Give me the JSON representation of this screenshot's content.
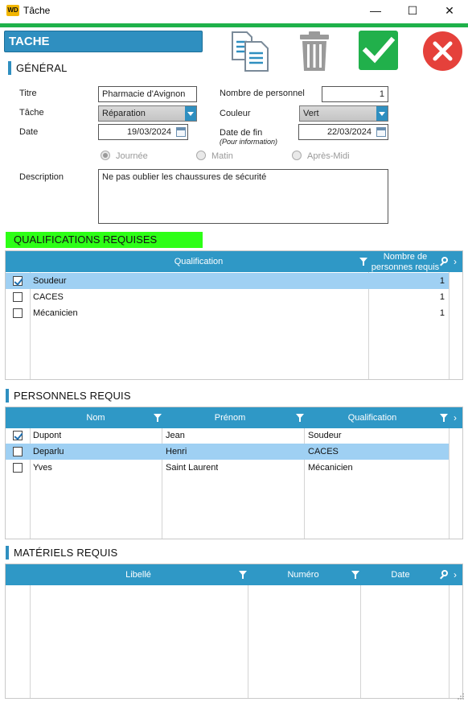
{
  "window": {
    "app_icon": "WD",
    "title": "Tâche",
    "min": "—",
    "max": "☐",
    "close": "✕"
  },
  "header": {
    "banner": "TACHE",
    "section_general": "GÉNÉRAL",
    "tools": [
      "copy-document-icon",
      "trash-icon",
      "validate-check-icon",
      "cancel-x-icon"
    ],
    "colors": {
      "accent": "#2f8fc0",
      "validate": "#21b04b",
      "cancel": "#e5413b",
      "green_line": "#1fb14a"
    }
  },
  "form": {
    "titre_label": "Titre",
    "titre_value": "Pharmacie d'Avignon",
    "tache_label": "Tâche",
    "tache_value": "Réparation",
    "date_label": "Date",
    "date_value": "19/03/2024",
    "nb_personnel_label": "Nombre de personnel",
    "nb_personnel_value": "1",
    "couleur_label": "Couleur",
    "couleur_value": "Vert",
    "date_fin_label": "Date de fin",
    "date_fin_sub": "(Pour information)",
    "date_fin_value": "22/03/2024",
    "radio_journee": "Journée",
    "radio_matin": "Matin",
    "radio_apres_midi": "Après-Midi",
    "description_label": "Description",
    "description_value": "Ne pas oublier les chaussures de sécurité"
  },
  "qualifications": {
    "title": "QUALIFICATIONS REQUISES",
    "col_qualification": "Qualification",
    "col_nombre_1": "Nombre de",
    "col_nombre_2": "personnes requis",
    "rows": [
      {
        "checked": true,
        "name": "Soudeur",
        "count": "1"
      },
      {
        "checked": false,
        "name": "CACES",
        "count": "1"
      },
      {
        "checked": false,
        "name": "Mécanicien",
        "count": "1"
      }
    ]
  },
  "personnels": {
    "title": "PERSONNELS REQUIS",
    "col_nom": "Nom",
    "col_prenom": "Prénom",
    "col_qualification": "Qualification",
    "rows": [
      {
        "checked": true,
        "nom": "Dupont",
        "prenom": "Jean",
        "qualification": "Soudeur"
      },
      {
        "checked": false,
        "nom": "Deparlu",
        "prenom": "Henri",
        "qualification": "CACES"
      },
      {
        "checked": false,
        "nom": "Yves",
        "prenom": "Saint Laurent",
        "qualification": "Mécanicien"
      }
    ]
  },
  "materiels": {
    "title": "MATÉRIELS REQUIS",
    "col_libelle": "Libellé",
    "col_numero": "Numéro",
    "col_date": "Date"
  }
}
